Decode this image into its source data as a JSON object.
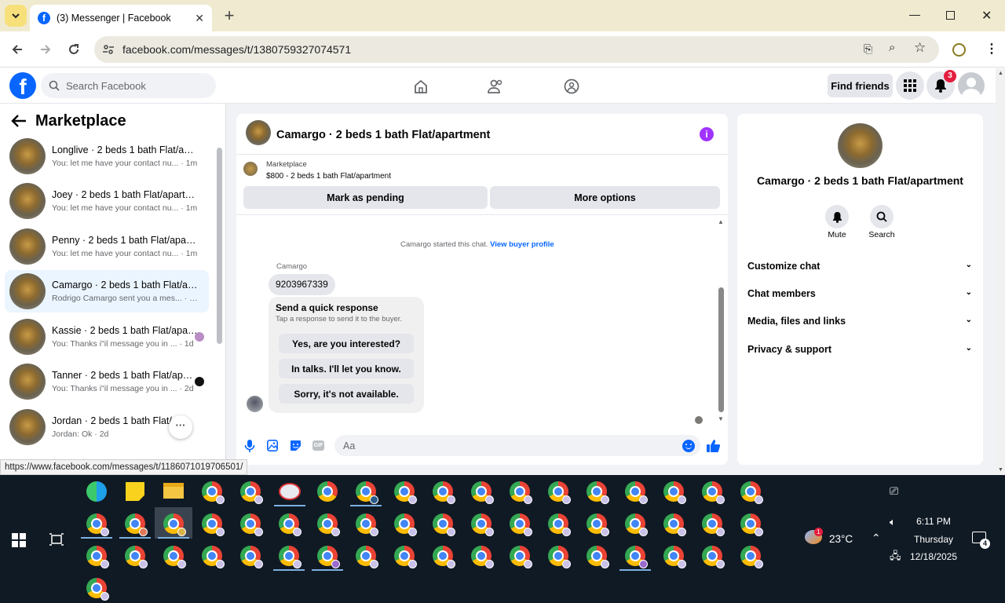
{
  "browser": {
    "tab_title": "(3) Messenger | Facebook",
    "url": "facebook.com/messages/t/1380759327074571",
    "status_url": "https://www.facebook.com/messages/t/1186071019706501/"
  },
  "header": {
    "search_placeholder": "Search Facebook",
    "find_friends": "Find friends",
    "notif_count": "3"
  },
  "sidebar": {
    "title": "Marketplace",
    "conversations": [
      {
        "name": "Longlive · 2 beds 1 bath Flat/apartment",
        "snippet": "You: let me have your contact nu...",
        "time": "1m"
      },
      {
        "name": "Joey · 2 beds 1 bath Flat/apartment",
        "snippet": "You: let me have your contact nu...",
        "time": "1m"
      },
      {
        "name": "Penny · 2 beds 1 bath Flat/apartment",
        "snippet": "You: let me have your contact nu...",
        "time": "1m"
      },
      {
        "name": "Camargo · 2 beds 1 bath Flat/apartment",
        "snippet": "Rodrigo Camargo sent you a mes...",
        "time": "10h"
      },
      {
        "name": "Kassie · 2 beds 1 bath Flat/apartment",
        "snippet": "You: Thanks i\"il message you in ...",
        "time": "1d"
      },
      {
        "name": "Tanner · 2 beds 1 bath Flat/apartment",
        "snippet": "You: Thanks i\"il message you in ...",
        "time": "2d"
      },
      {
        "name": "Jordan · 2 beds 1 bath Flat/apartment",
        "snippet": "Jordan: Ok",
        "time": "2d"
      }
    ]
  },
  "chat": {
    "title": "Camargo · 2 beds 1 bath Flat/apartment",
    "listing_label": "Marketplace",
    "listing_price": "$800 - 2 beds 1 bath Flat/apartment",
    "mark_pending": "Mark as pending",
    "more_options": "More options",
    "started_text": "Camargo started this chat.",
    "view_buyer": "View buyer profile",
    "sender": "Camargo",
    "message": "9203967339",
    "quick_title": "Send a quick response",
    "quick_sub": "Tap a response to send it to the buyer.",
    "quick_replies": [
      "Yes, are you interested?",
      "In talks. I'll let you know.",
      "Sorry, it's not available."
    ],
    "composer_placeholder": "Aa"
  },
  "details": {
    "title": "Camargo · 2 beds 1 bath Flat/apartment",
    "mute": "Mute",
    "search": "Search",
    "sections": [
      "Customize chat",
      "Chat members",
      "Media, files and links",
      "Privacy & support"
    ]
  },
  "taskbar": {
    "temp": "23°C",
    "time": "6:11 PM",
    "day": "Thursday",
    "date": "12/18/2025",
    "notif_badge": "4",
    "weather_badge": "1"
  },
  "colors": {
    "fb_blue": "#0866ff",
    "messenger_purple": "#a033ff",
    "taskbar": "#101a24"
  }
}
